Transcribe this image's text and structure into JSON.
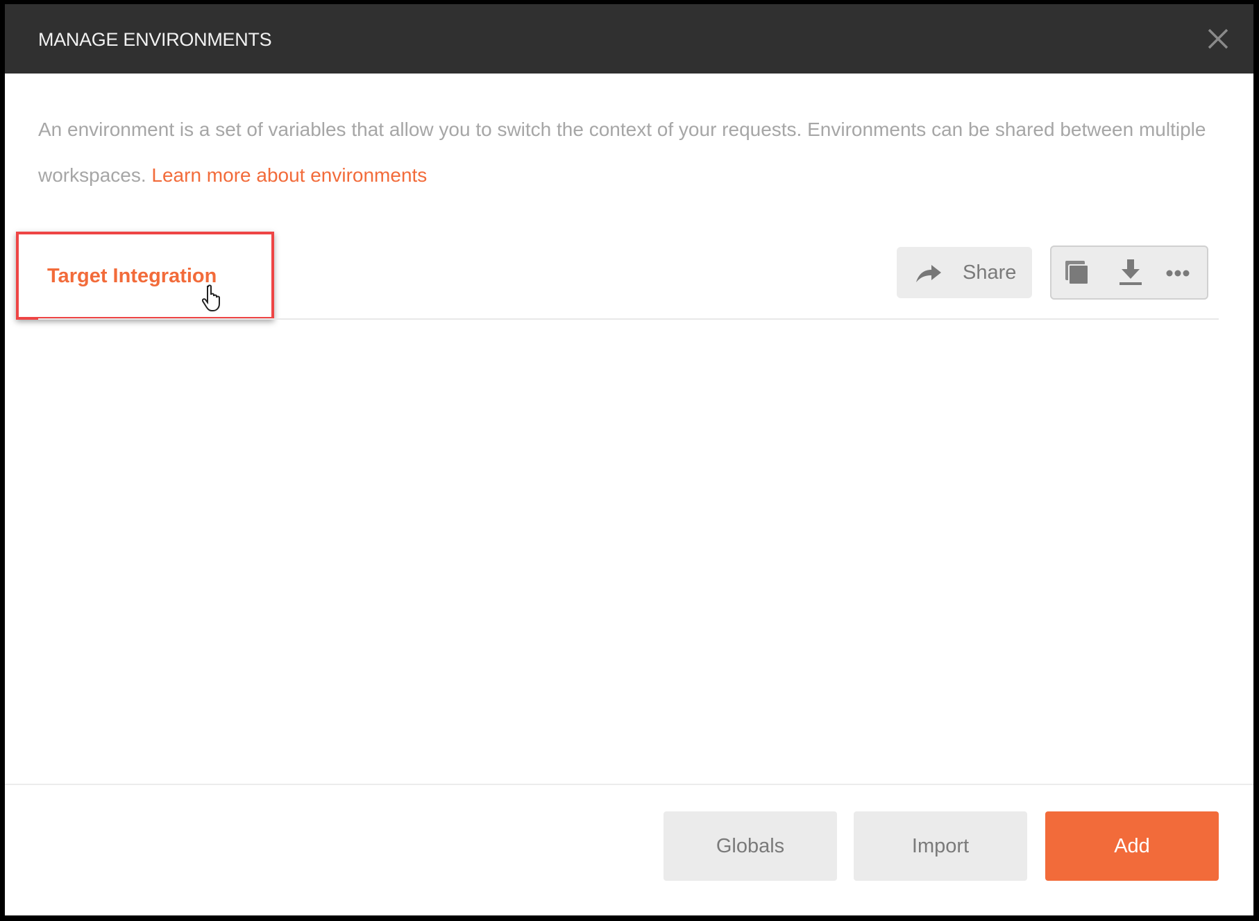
{
  "dialog": {
    "title": "MANAGE ENVIRONMENTS",
    "close_icon": "close-icon",
    "description": "An environment is a set of variables that allow you to switch the context of your requests. Environments can be shared between multiple workspaces.",
    "learn_more_link": "Learn more about environments"
  },
  "environments": [
    {
      "name": "Target Integration"
    }
  ],
  "actions": {
    "share_label": "Share",
    "icons": [
      "duplicate-icon",
      "download-icon",
      "more-icon"
    ]
  },
  "footer": {
    "globals_label": "Globals",
    "import_label": "Import",
    "add_label": "Add"
  },
  "colors": {
    "accent": "#f26b3a",
    "header": "#303030",
    "highlight": "#ee4545"
  }
}
